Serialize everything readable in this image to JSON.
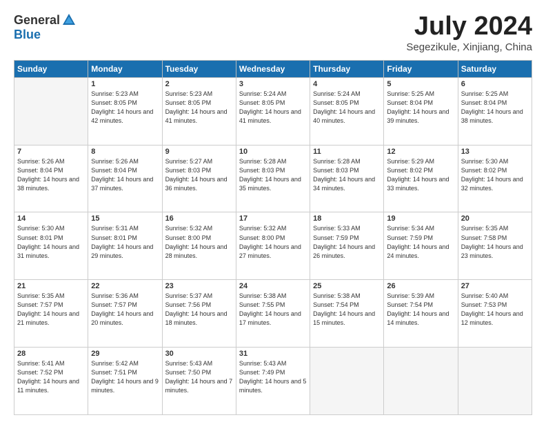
{
  "logo": {
    "general": "General",
    "blue": "Blue"
  },
  "title": "July 2024",
  "location": "Segezikule, Xinjiang, China",
  "days_header": [
    "Sunday",
    "Monday",
    "Tuesday",
    "Wednesday",
    "Thursday",
    "Friday",
    "Saturday"
  ],
  "weeks": [
    [
      {
        "day": null
      },
      {
        "day": "1",
        "sunrise": "5:23 AM",
        "sunset": "8:05 PM",
        "daylight": "14 hours and 42 minutes."
      },
      {
        "day": "2",
        "sunrise": "5:23 AM",
        "sunset": "8:05 PM",
        "daylight": "14 hours and 41 minutes."
      },
      {
        "day": "3",
        "sunrise": "5:24 AM",
        "sunset": "8:05 PM",
        "daylight": "14 hours and 41 minutes."
      },
      {
        "day": "4",
        "sunrise": "5:24 AM",
        "sunset": "8:05 PM",
        "daylight": "14 hours and 40 minutes."
      },
      {
        "day": "5",
        "sunrise": "5:25 AM",
        "sunset": "8:04 PM",
        "daylight": "14 hours and 39 minutes."
      },
      {
        "day": "6",
        "sunrise": "5:25 AM",
        "sunset": "8:04 PM",
        "daylight": "14 hours and 38 minutes."
      }
    ],
    [
      {
        "day": "7",
        "sunrise": "5:26 AM",
        "sunset": "8:04 PM",
        "daylight": "14 hours and 38 minutes."
      },
      {
        "day": "8",
        "sunrise": "5:26 AM",
        "sunset": "8:04 PM",
        "daylight": "14 hours and 37 minutes."
      },
      {
        "day": "9",
        "sunrise": "5:27 AM",
        "sunset": "8:03 PM",
        "daylight": "14 hours and 36 minutes."
      },
      {
        "day": "10",
        "sunrise": "5:28 AM",
        "sunset": "8:03 PM",
        "daylight": "14 hours and 35 minutes."
      },
      {
        "day": "11",
        "sunrise": "5:28 AM",
        "sunset": "8:03 PM",
        "daylight": "14 hours and 34 minutes."
      },
      {
        "day": "12",
        "sunrise": "5:29 AM",
        "sunset": "8:02 PM",
        "daylight": "14 hours and 33 minutes."
      },
      {
        "day": "13",
        "sunrise": "5:30 AM",
        "sunset": "8:02 PM",
        "daylight": "14 hours and 32 minutes."
      }
    ],
    [
      {
        "day": "14",
        "sunrise": "5:30 AM",
        "sunset": "8:01 PM",
        "daylight": "14 hours and 31 minutes."
      },
      {
        "day": "15",
        "sunrise": "5:31 AM",
        "sunset": "8:01 PM",
        "daylight": "14 hours and 29 minutes."
      },
      {
        "day": "16",
        "sunrise": "5:32 AM",
        "sunset": "8:00 PM",
        "daylight": "14 hours and 28 minutes."
      },
      {
        "day": "17",
        "sunrise": "5:32 AM",
        "sunset": "8:00 PM",
        "daylight": "14 hours and 27 minutes."
      },
      {
        "day": "18",
        "sunrise": "5:33 AM",
        "sunset": "7:59 PM",
        "daylight": "14 hours and 26 minutes."
      },
      {
        "day": "19",
        "sunrise": "5:34 AM",
        "sunset": "7:59 PM",
        "daylight": "14 hours and 24 minutes."
      },
      {
        "day": "20",
        "sunrise": "5:35 AM",
        "sunset": "7:58 PM",
        "daylight": "14 hours and 23 minutes."
      }
    ],
    [
      {
        "day": "21",
        "sunrise": "5:35 AM",
        "sunset": "7:57 PM",
        "daylight": "14 hours and 21 minutes."
      },
      {
        "day": "22",
        "sunrise": "5:36 AM",
        "sunset": "7:57 PM",
        "daylight": "14 hours and 20 minutes."
      },
      {
        "day": "23",
        "sunrise": "5:37 AM",
        "sunset": "7:56 PM",
        "daylight": "14 hours and 18 minutes."
      },
      {
        "day": "24",
        "sunrise": "5:38 AM",
        "sunset": "7:55 PM",
        "daylight": "14 hours and 17 minutes."
      },
      {
        "day": "25",
        "sunrise": "5:38 AM",
        "sunset": "7:54 PM",
        "daylight": "14 hours and 15 minutes."
      },
      {
        "day": "26",
        "sunrise": "5:39 AM",
        "sunset": "7:54 PM",
        "daylight": "14 hours and 14 minutes."
      },
      {
        "day": "27",
        "sunrise": "5:40 AM",
        "sunset": "7:53 PM",
        "daylight": "14 hours and 12 minutes."
      }
    ],
    [
      {
        "day": "28",
        "sunrise": "5:41 AM",
        "sunset": "7:52 PM",
        "daylight": "14 hours and 11 minutes."
      },
      {
        "day": "29",
        "sunrise": "5:42 AM",
        "sunset": "7:51 PM",
        "daylight": "14 hours and 9 minutes."
      },
      {
        "day": "30",
        "sunrise": "5:43 AM",
        "sunset": "7:50 PM",
        "daylight": "14 hours and 7 minutes."
      },
      {
        "day": "31",
        "sunrise": "5:43 AM",
        "sunset": "7:49 PM",
        "daylight": "14 hours and 5 minutes."
      },
      {
        "day": null
      },
      {
        "day": null
      },
      {
        "day": null
      }
    ]
  ]
}
